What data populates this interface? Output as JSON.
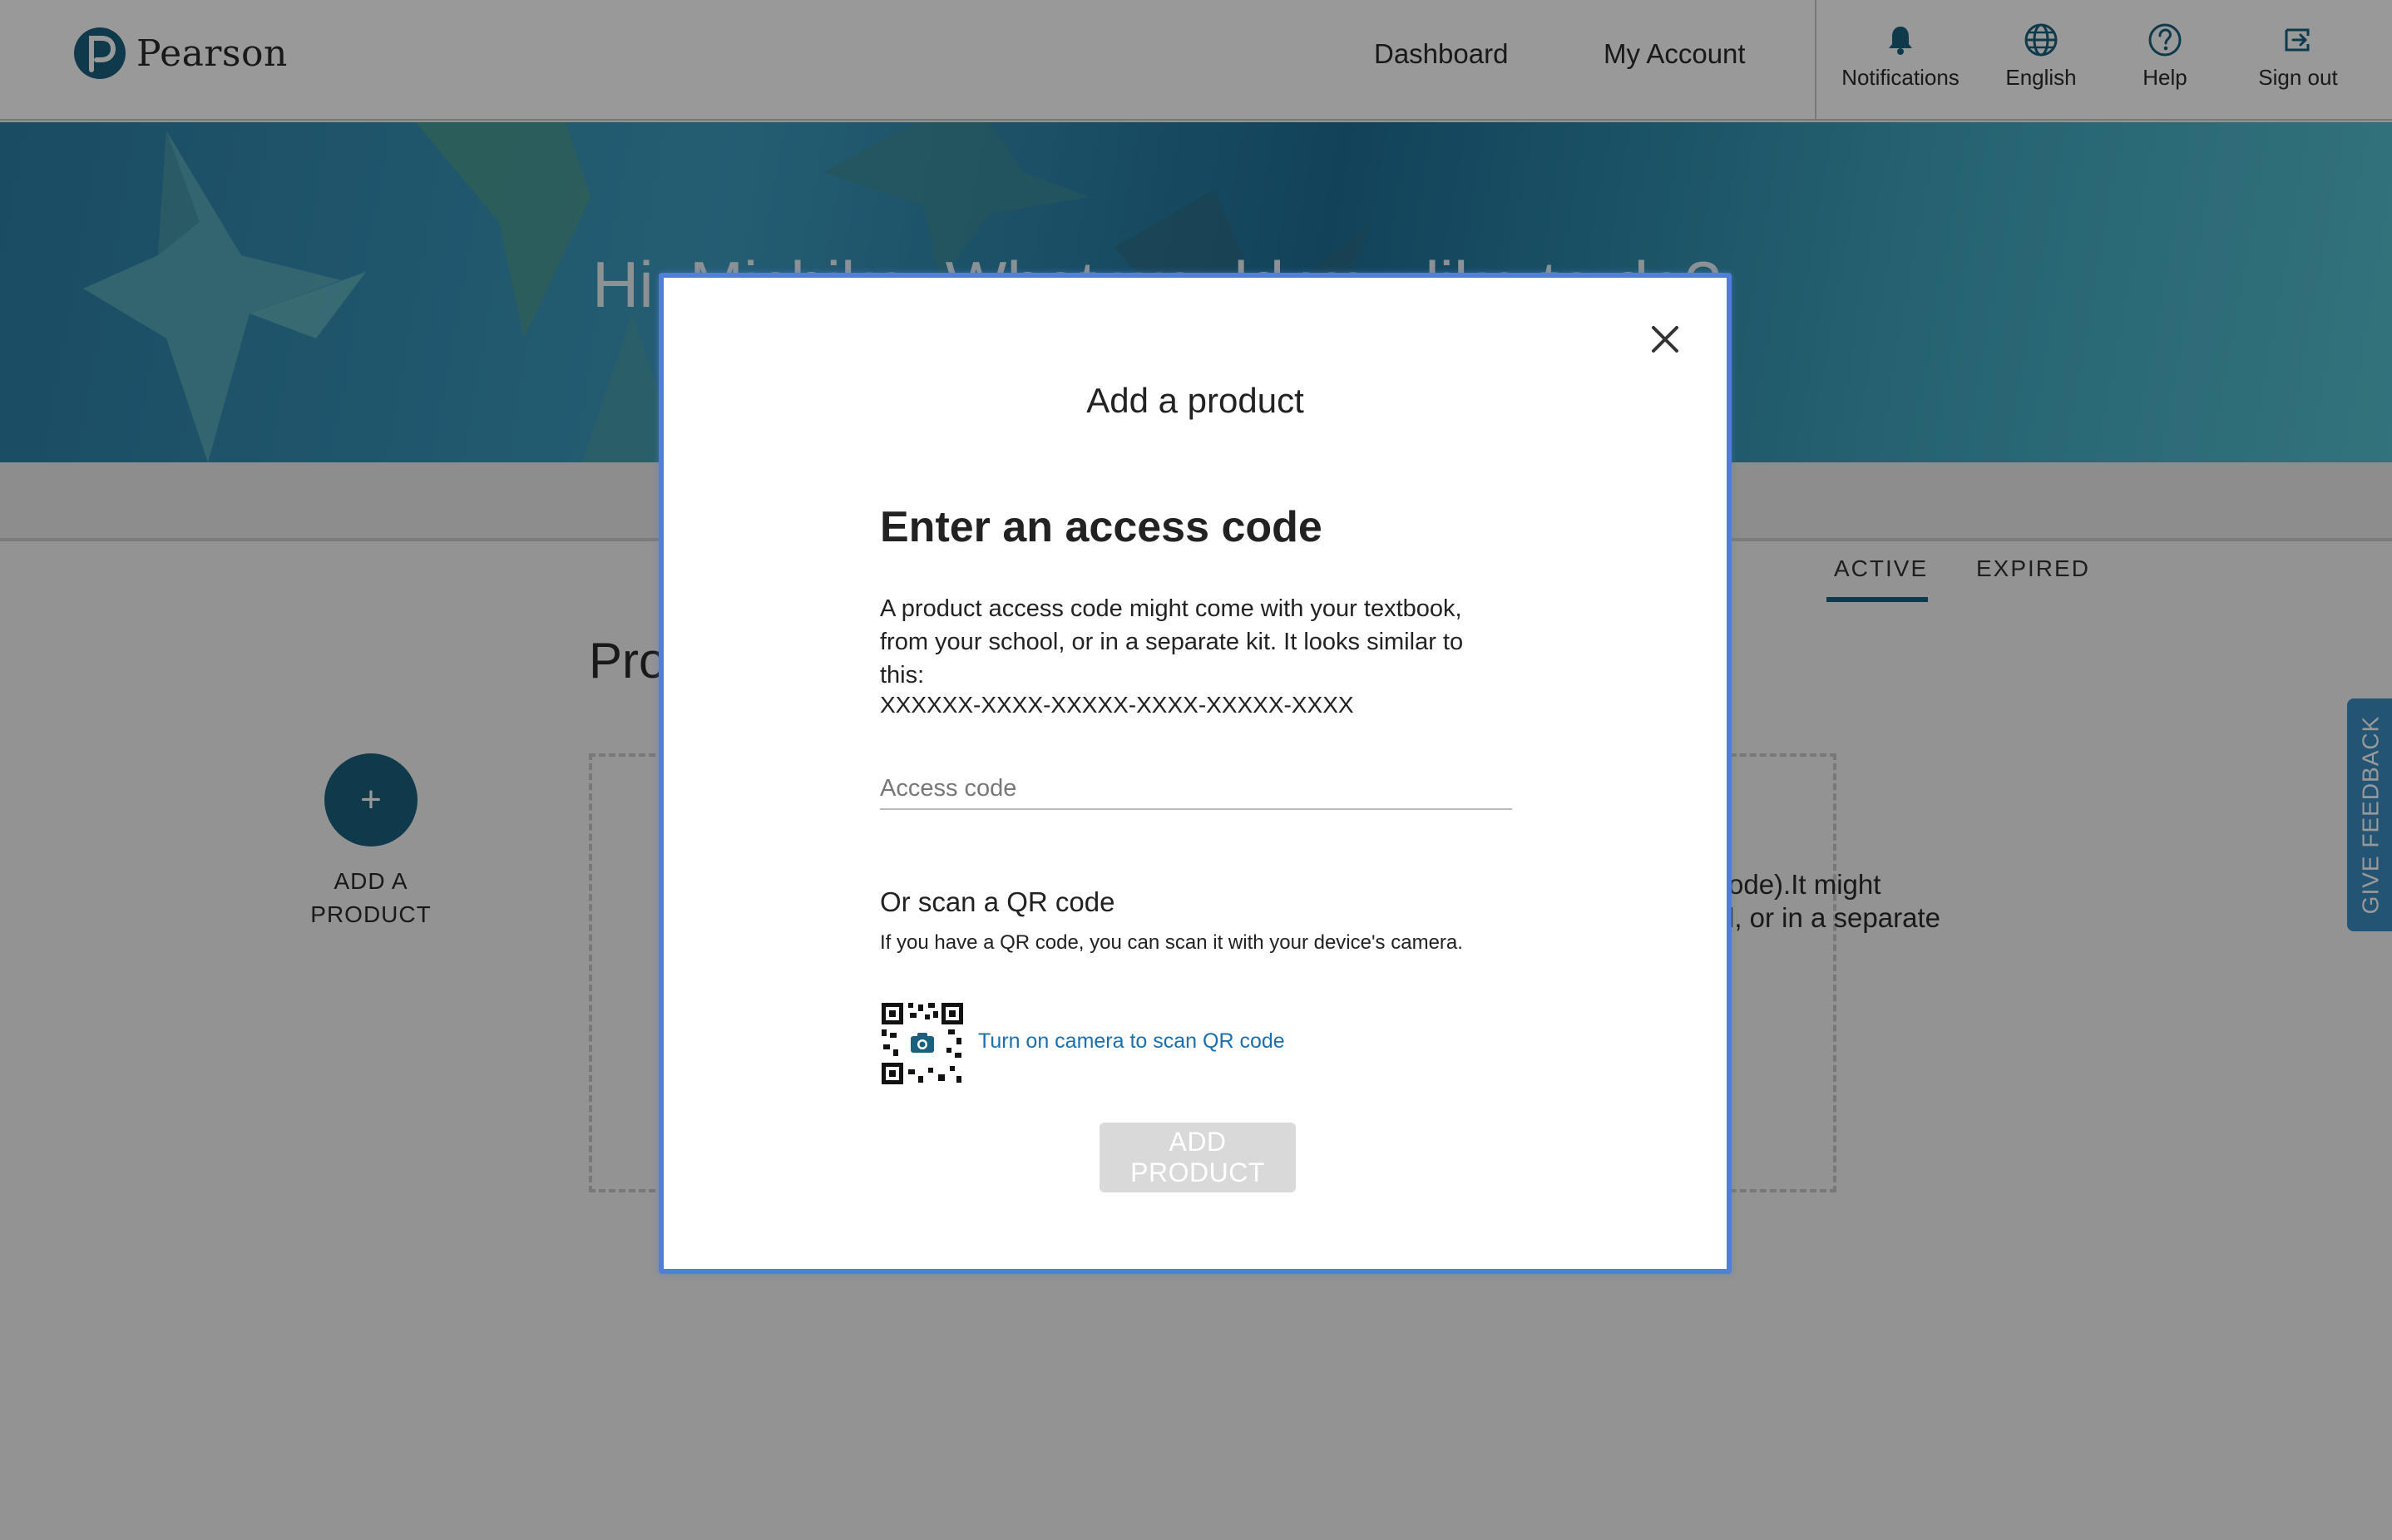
{
  "header": {
    "brand": "Pearson",
    "nav": {
      "dashboard": "Dashboard",
      "my_account": "My Account"
    },
    "utilities": {
      "notifications": "Notifications",
      "language": "English",
      "help": "Help",
      "sign_out": "Sign out"
    }
  },
  "hero": {
    "greeting": "Hi, Michiko. What would you like to do?"
  },
  "tabs": {
    "active": "ACTIVE",
    "expired": "EXPIRED"
  },
  "main": {
    "section_title": "Products",
    "add_product_label": "ADD A PRODUCT",
    "add_icon": "+",
    "behind_text_line1": "ode).It might",
    "behind_text_line2": "l, or in a separate"
  },
  "feedback": {
    "label": "GIVE FEEDBACK"
  },
  "modal": {
    "title": "Add a product",
    "heading": "Enter an access code",
    "description": "A product access code might come with your textbook, from your school, or in a separate kit. It looks similar to this:",
    "code_example": "XXXXXX-XXXX-XXXXX-XXXX-XXXXX-XXXX",
    "access_code_placeholder": "Access code",
    "access_code_value": "",
    "qr_heading": "Or scan a QR code",
    "qr_description": "If you have a QR code, you can scan it with your device's camera.",
    "qr_link": "Turn on camera to scan QR code",
    "submit_label": "ADD PRODUCT",
    "submit_disabled": true
  },
  "colors": {
    "brand_teal": "#19627f",
    "link_blue": "#1a6fb0",
    "modal_focus_border": "#4f7fd8",
    "disabled_button": "#d9d9d9",
    "feedback_tab": "#3b8dc0"
  },
  "icons": [
    "pearson-logo",
    "bell-icon",
    "globe-icon",
    "help-circle-icon",
    "sign-out-icon",
    "plus-icon",
    "close-icon",
    "qr-code-icon",
    "camera-icon"
  ]
}
